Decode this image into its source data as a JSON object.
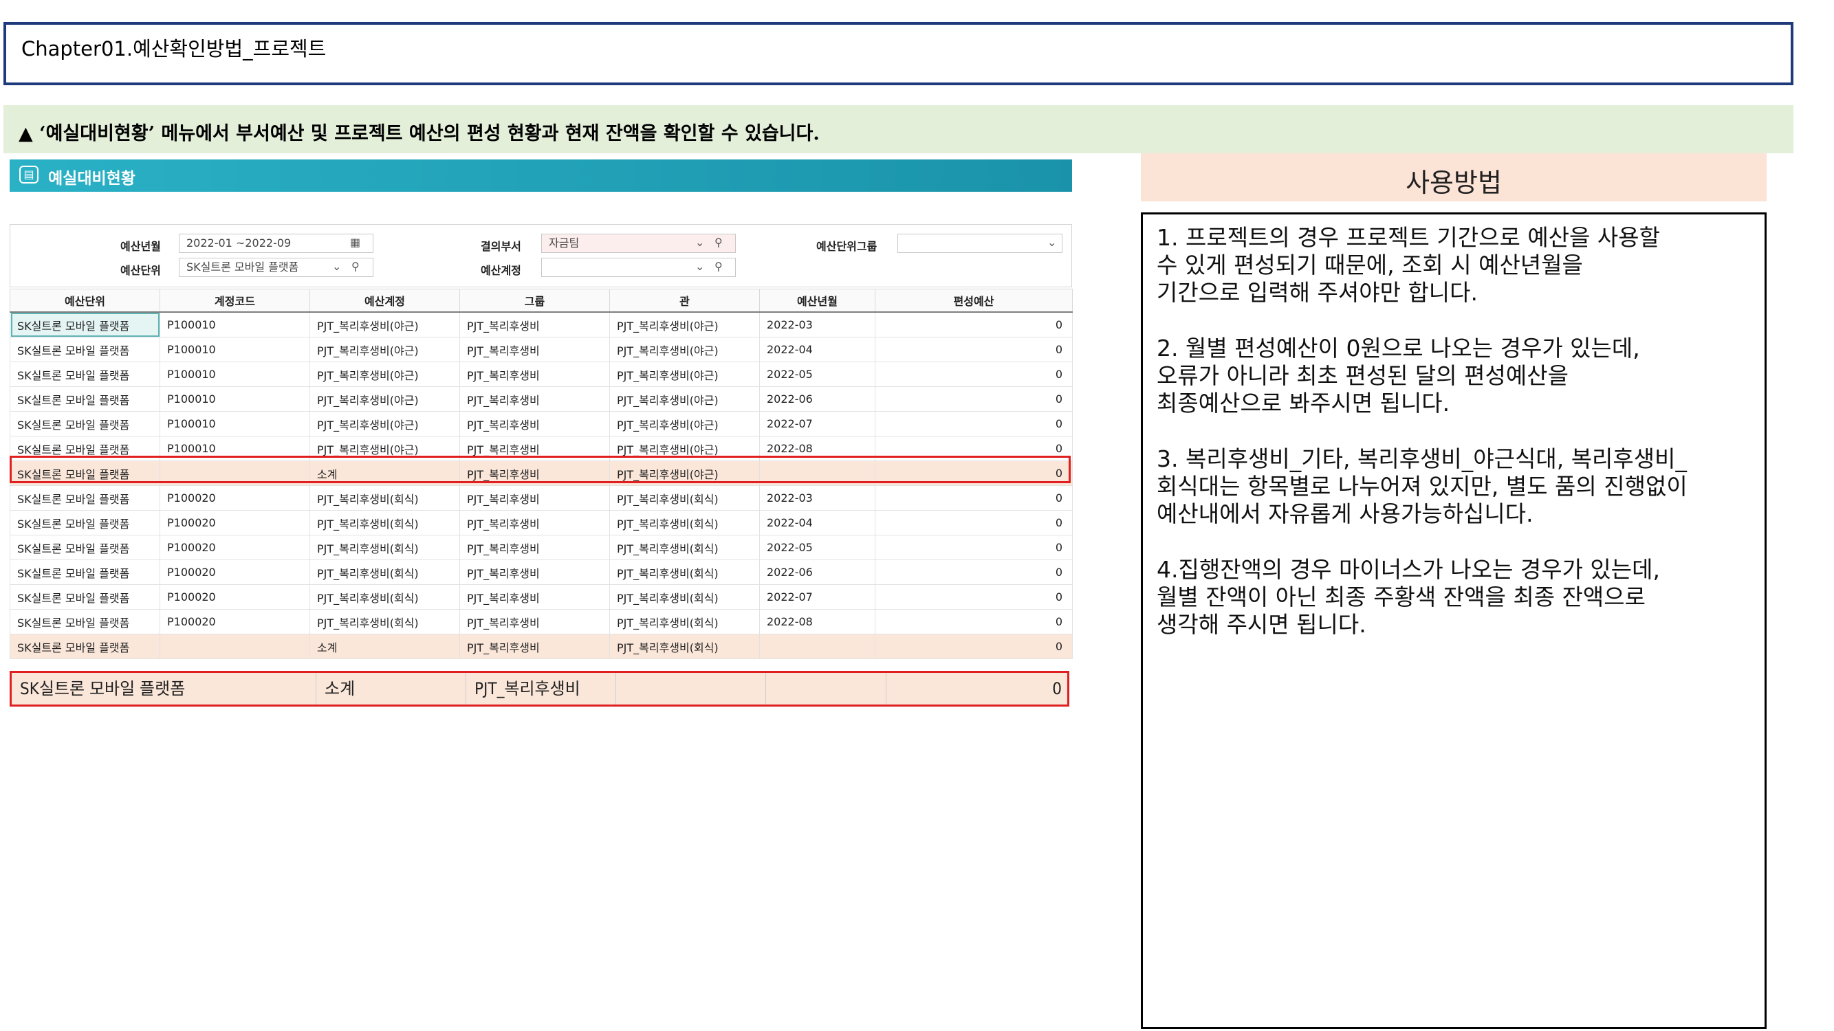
{
  "chapter": {
    "title": "Chapter01.예산확인방법_프로젝트"
  },
  "banner": {
    "text": "▲ ‘예실대비현황’ 메뉴에서 부서예산 및 프로젝트 예산의 편성 현황과 현재 잔액을 확인할 수 있습니다."
  },
  "screen": {
    "title": "예실대비현황",
    "search": {
      "budget_period_label": "예산년월",
      "budget_period_value": "2022-01 ~2022-09",
      "budget_unit_label": "예산단위",
      "budget_unit_value": "SK실트론 모바일 플랫폼",
      "approval_dept_label": "결의부서",
      "approval_dept_value": "자금팀",
      "budget_account_label": "예산계정",
      "budget_account_value": "",
      "budget_group_label": "예산단위그룹",
      "budget_group_value": ""
    },
    "columns": [
      "예산단위",
      "계정코드",
      "예산계정",
      "그룹",
      "관",
      "예산년월",
      "편성예산"
    ],
    "rows": [
      [
        "SK실트론 모바일 플랫폼",
        "P100010",
        "PJT_복리후생비(야근)",
        "PJT_복리후생비",
        "PJT_복리후생비(야근)",
        "2022-03",
        "0"
      ],
      [
        "SK실트론 모바일 플랫폼",
        "P100010",
        "PJT_복리후생비(야근)",
        "PJT_복리후생비",
        "PJT_복리후생비(야근)",
        "2022-04",
        "0"
      ],
      [
        "SK실트론 모바일 플랫폼",
        "P100010",
        "PJT_복리후생비(야근)",
        "PJT_복리후생비",
        "PJT_복리후생비(야근)",
        "2022-05",
        "0"
      ],
      [
        "SK실트론 모바일 플랫폼",
        "P100010",
        "PJT_복리후생비(야근)",
        "PJT_복리후생비",
        "PJT_복리후생비(야근)",
        "2022-06",
        "0"
      ],
      [
        "SK실트론 모바일 플랫폼",
        "P100010",
        "PJT_복리후생비(야근)",
        "PJT_복리후생비",
        "PJT_복리후생비(야근)",
        "2022-07",
        "0"
      ],
      [
        "SK실트론 모바일 플랫폼",
        "P100010",
        "PJT_복리후생비(야근)",
        "PJT_복리후생비",
        "PJT_복리후생비(야근)",
        "2022-08",
        "0"
      ],
      [
        "SK실트론 모바일 플랫폼",
        "",
        "소계",
        "PJT_복리후생비",
        "PJT_복리후생비(야근)",
        "",
        "0"
      ],
      [
        "SK실트론 모바일 플랫폼",
        "P100020",
        "PJT_복리후생비(회식)",
        "PJT_복리후생비",
        "PJT_복리후생비(회식)",
        "2022-03",
        "0"
      ],
      [
        "SK실트론 모바일 플랫폼",
        "P100020",
        "PJT_복리후생비(회식)",
        "PJT_복리후생비",
        "PJT_복리후생비(회식)",
        "2022-04",
        "0"
      ],
      [
        "SK실트론 모바일 플랫폼",
        "P100020",
        "PJT_복리후생비(회식)",
        "PJT_복리후생비",
        "PJT_복리후생비(회식)",
        "2022-05",
        "0"
      ],
      [
        "SK실트론 모바일 플랫폼",
        "P100020",
        "PJT_복리후생비(회식)",
        "PJT_복리후생비",
        "PJT_복리후생비(회식)",
        "2022-06",
        "0"
      ],
      [
        "SK실트론 모바일 플랫폼",
        "P100020",
        "PJT_복리후생비(회식)",
        "PJT_복리후생비",
        "PJT_복리후생비(회식)",
        "2022-07",
        "0"
      ],
      [
        "SK실트론 모바일 플랫폼",
        "P100020",
        "PJT_복리후생비(회식)",
        "PJT_복리후생비",
        "PJT_복리후생비(회식)",
        "2022-08",
        "0"
      ],
      [
        "SK실트론 모바일 플랫폼",
        "",
        "소계",
        "PJT_복리후생비",
        "PJT_복리후생비(회식)",
        "",
        "0"
      ]
    ],
    "subtotal_rows": [
      6,
      13
    ],
    "total": {
      "unit": "SK실트론 모바일 플랫폼",
      "label": "소계",
      "group": "PJT_복리후생비",
      "value": "0"
    }
  },
  "usage": {
    "header": "사용방법",
    "items": [
      "1.  프로젝트의 경우 프로젝트 기간으로 예산을 사용할\n     수 있게 편성되기 때문에, 조회 시 예산년월을\n     기간으로 입력해 주셔야만 합니다.",
      "2. 월별 편성예산이 0원으로 나오는 경우가 있는데,\n오류가 아니라 최초 편성된 달의 편성예산을\n최종예산으로 봐주시면 됩니다.",
      "3. 복리후생비_기타, 복리후생비_야근식대, 복리후생비_\n회식대는 항목별로 나누어져 있지만, 별도 품의 진행없이\n예산내에서 자유롭게 사용가능하십니다.",
      "4.집행잔액의 경우 마이너스가 나오는 경우가 있는데,\n월별 잔액이 아닌 최종 주황색 잔액을 최종 잔액으로\n생각해 주시면 됩니다."
    ]
  }
}
